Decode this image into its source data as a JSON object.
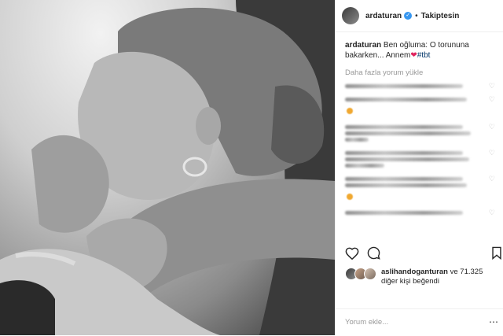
{
  "post": {
    "username": "ardaturan",
    "follow_label": "Takiptesin",
    "caption_username": "ardaturan",
    "caption_text": "Ben oğluma: O torununa bakarken... Annem",
    "caption_heart": "❤",
    "caption_tag": "#tbt",
    "load_more": "Daha fazla yorum yükle",
    "liked_by_user": "aslihandoganturan",
    "liked_by_rest": "ve 71.325 diğer kişi beğendi",
    "add_comment_placeholder": "Yorum ekle..."
  },
  "icons": {
    "like": "heart-icon",
    "comment": "comment-icon",
    "bookmark": "bookmark-icon",
    "verified": "verified-badge-icon"
  },
  "colors": {
    "verified": "#3897f0",
    "heart": "#e0245e",
    "muted": "#999999"
  }
}
